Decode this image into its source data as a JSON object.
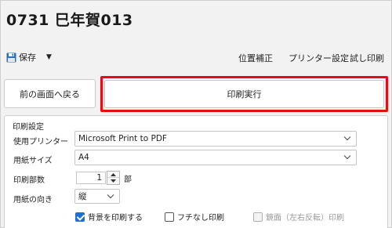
{
  "header": {
    "title": "0731 巳年賀013"
  },
  "toolbar": {
    "save_label": "保存",
    "caret": "▼",
    "items": [
      "位置補正",
      "プリンター設定",
      "試し印刷"
    ]
  },
  "actions": {
    "back_label": "前の画面へ戻る",
    "run_label": "印刷実行"
  },
  "settings": {
    "title": "印刷設定",
    "printer_label": "使用プリンター",
    "printer_value": "Microsoft Print to PDF",
    "paper_label": "用紙サイズ",
    "paper_value": "A4",
    "copies_label": "印刷部数",
    "copies_value": "1",
    "copies_unit": "部",
    "orientation_label": "用紙の向き",
    "orientation_value": "縦",
    "checkboxes": [
      {
        "label": "背景を印刷する",
        "checked": true,
        "enabled": true
      },
      {
        "label": "フチなし印刷",
        "checked": false,
        "enabled": true
      },
      {
        "label": "鏡面（左右反転）印刷",
        "checked": false,
        "enabled": false
      }
    ]
  },
  "colors": {
    "highlight_border": "#e30f14",
    "checkbox_accent": "#1e6fd0"
  }
}
